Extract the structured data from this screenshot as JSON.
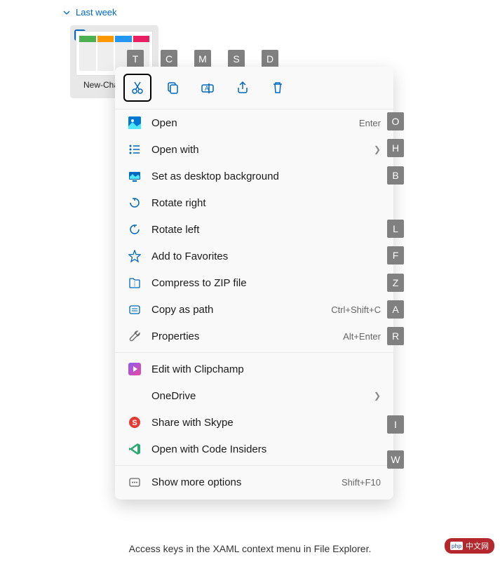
{
  "section": {
    "label": "Last week"
  },
  "file": {
    "name": "New-Cha…\ner…"
  },
  "toolbar_keys": {
    "cut": "T",
    "copy": "C",
    "rename": "M",
    "share": "S",
    "delete": "D"
  },
  "toolbar": {
    "cut": "cut",
    "copy": "copy",
    "rename": "rename",
    "share": "share",
    "delete": "delete"
  },
  "menu": {
    "open": {
      "label": "Open",
      "shortcut": "Enter",
      "key": "O"
    },
    "open_with": {
      "label": "Open with",
      "key": "H"
    },
    "set_bg": {
      "label": "Set as desktop background",
      "key": "B"
    },
    "rotate_right": {
      "label": "Rotate right"
    },
    "rotate_left": {
      "label": "Rotate left",
      "key": "L"
    },
    "favorites": {
      "label": "Add to Favorites",
      "key": "F"
    },
    "compress": {
      "label": "Compress to ZIP file",
      "key": "Z"
    },
    "copy_path": {
      "label": "Copy as path",
      "shortcut": "Ctrl+Shift+C",
      "key": "A"
    },
    "properties": {
      "label": "Properties",
      "shortcut": "Alt+Enter",
      "key": "R"
    },
    "clipchamp": {
      "label": "Edit with Clipchamp"
    },
    "onedrive": {
      "label": "OneDrive"
    },
    "skype": {
      "label": "Share with Skype",
      "key": "I"
    },
    "code": {
      "label": "Open with Code Insiders",
      "key": "W"
    },
    "more": {
      "label": "Show more options",
      "shortcut": "Shift+F10"
    }
  },
  "caption": "Access keys in the XAML context menu in File Explorer.",
  "watermark": "中文网"
}
